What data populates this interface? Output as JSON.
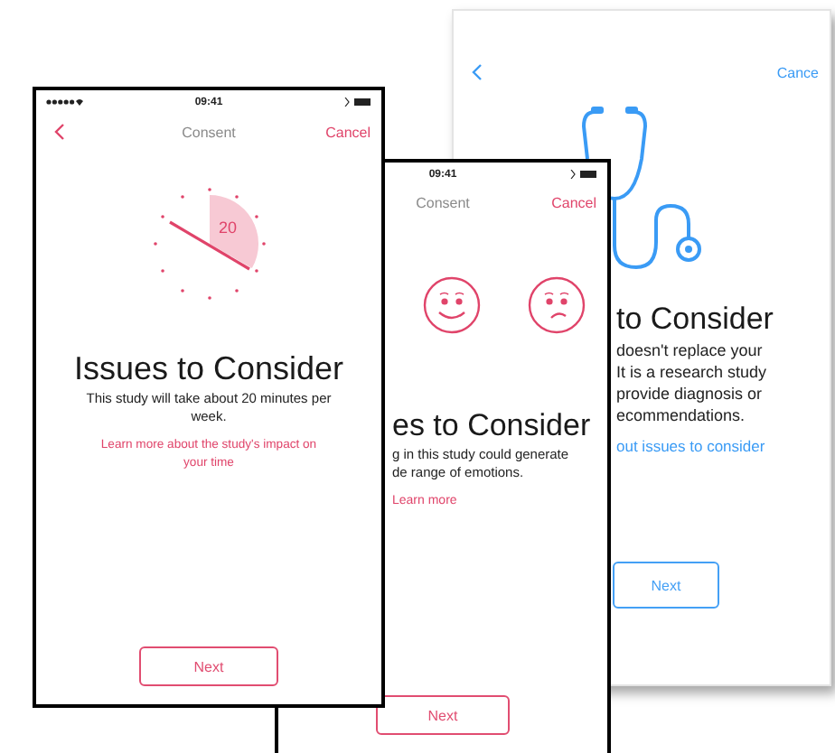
{
  "screens": [
    {
      "kind": "stethoscope",
      "color": "#3a9bf5",
      "nav": {
        "back": true,
        "cancel": "Cance"
      },
      "title": "to Consider",
      "body": [
        "doesn't replace your",
        "It is a research study",
        "provide diagnosis or",
        "ecommendations."
      ],
      "link": "out issues to consider",
      "button": "Next"
    },
    {
      "kind": "emotions",
      "color": "#e0446a",
      "status_bar": {
        "time": "09:41"
      },
      "nav": {
        "title": "Consent",
        "cancel": "Cancel"
      },
      "title": "es to Consider",
      "body": [
        "g in this study could generate",
        "de range of emotions."
      ],
      "link": "Learn more",
      "button": "Next"
    },
    {
      "kind": "time",
      "color": "#e0446a",
      "status_bar": {
        "time": "09:41"
      },
      "nav": {
        "back": true,
        "title": "Consent",
        "cancel": "Cancel"
      },
      "clock_label": "20",
      "title": "Issues to Consider",
      "body": [
        "This study will take about 20 minutes per week."
      ],
      "link": "Learn more about the study's impact on your time",
      "button": "Next"
    }
  ]
}
